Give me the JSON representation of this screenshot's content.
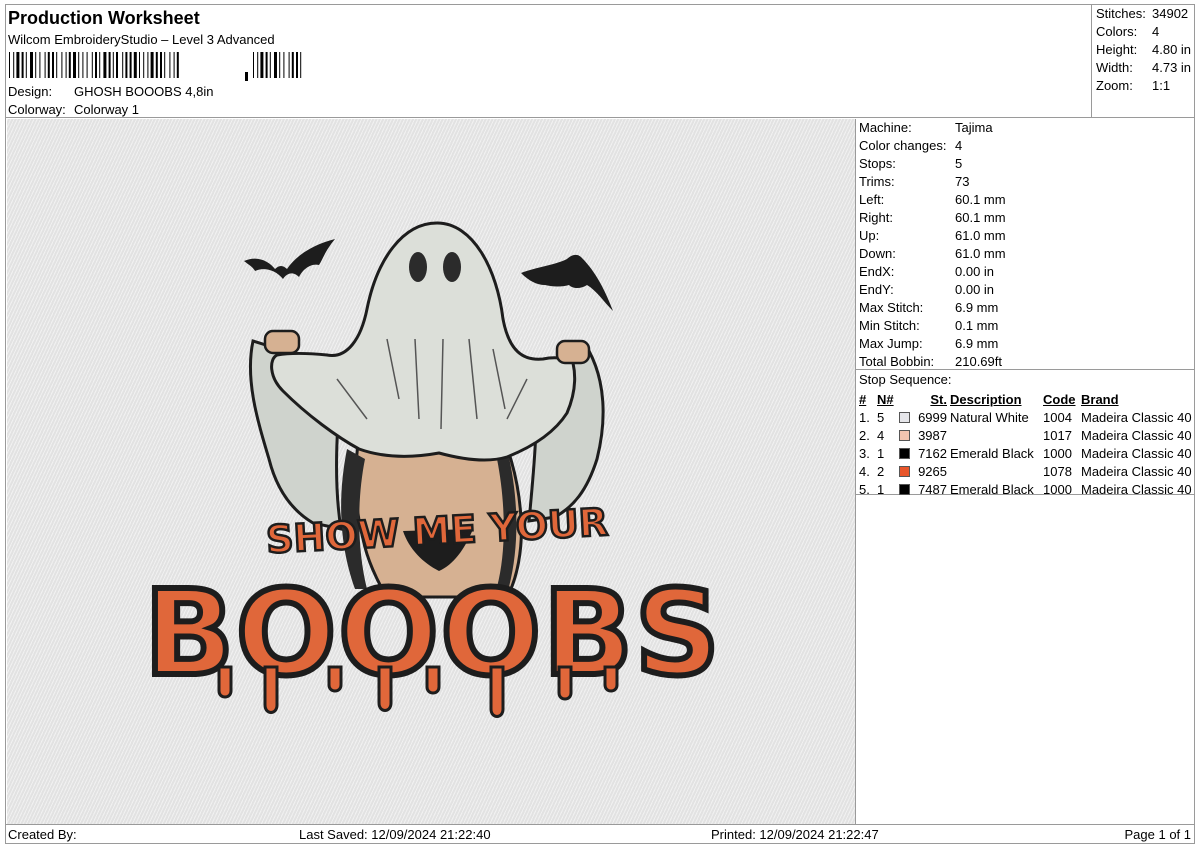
{
  "header": {
    "title": "Production Worksheet",
    "subtitle": "Wilcom EmbroideryStudio – Level 3 Advanced",
    "design_label": "Design:",
    "design_value": "GHOSH BOOOBS  4,8in",
    "colorway_label": "Colorway:",
    "colorway_value": "Colorway 1"
  },
  "summary": [
    {
      "label": "Stitches:",
      "value": "34902"
    },
    {
      "label": "Colors:",
      "value": "4"
    },
    {
      "label": "Height:",
      "value": "4.80 in"
    },
    {
      "label": "Width:",
      "value": "4.73 in"
    },
    {
      "label": "Zoom:",
      "value": "1:1"
    }
  ],
  "machine_info": [
    {
      "label": "Machine:",
      "value": "Tajima"
    },
    {
      "label": "Color changes:",
      "value": "4"
    },
    {
      "label": "Stops:",
      "value": "5"
    },
    {
      "label": "Trims:",
      "value": "73"
    },
    {
      "label": "Left:",
      "value": "60.1 mm"
    },
    {
      "label": "Right:",
      "value": "60.1 mm"
    },
    {
      "label": "Up:",
      "value": "61.0 mm"
    },
    {
      "label": "Down:",
      "value": "61.0 mm"
    },
    {
      "label": "EndX:",
      "value": "0.00 in"
    },
    {
      "label": "EndY:",
      "value": "0.00 in"
    },
    {
      "label": "Max Stitch:",
      "value": "6.9 mm"
    },
    {
      "label": "Min Stitch:",
      "value": "0.1 mm"
    },
    {
      "label": "Max Jump:",
      "value": "6.9 mm"
    },
    {
      "label": "Total Bobbin:",
      "value": "210.69ft"
    }
  ],
  "stop_sequence": {
    "caption": "Stop Sequence:",
    "headers": [
      "#",
      "N#",
      "St.",
      "Description",
      "Code",
      "Brand"
    ],
    "rows": [
      {
        "num": "1.",
        "n": "5",
        "color": "#e6e6ea",
        "st": "6999",
        "desc": "Natural White",
        "code": "1004",
        "brand": "Madeira Classic 40"
      },
      {
        "num": "2.",
        "n": "4",
        "color": "#f2c4b0",
        "st": "3987",
        "desc": "",
        "code": "1017",
        "brand": "Madeira Classic 40"
      },
      {
        "num": "3.",
        "n": "1",
        "color": "#000000",
        "st": "7162",
        "desc": "Emerald Black",
        "code": "1000",
        "brand": "Madeira Classic 40"
      },
      {
        "num": "4.",
        "n": "2",
        "color": "#e8552a",
        "st": "9265",
        "desc": "",
        "code": "1078",
        "brand": "Madeira Classic 40"
      },
      {
        "num": "5.",
        "n": "1",
        "color": "#000000",
        "st": "7487",
        "desc": "Emerald Black",
        "code": "1000",
        "brand": "Madeira Classic 40"
      }
    ]
  },
  "design": {
    "small_text": "SHOW ME YOUR",
    "big_text": "BOOOBS",
    "colors": {
      "orange": "#e0673a",
      "ghost": "#dcdfd9",
      "skin": "#d9b394",
      "black": "#1d1d1d"
    }
  },
  "footer": {
    "created_by": "Created By:",
    "last_saved": "Last Saved: 12/09/2024 21:22:40",
    "printed": "Printed: 12/09/2024 21:22:47",
    "page": "Page 1 of 1"
  }
}
